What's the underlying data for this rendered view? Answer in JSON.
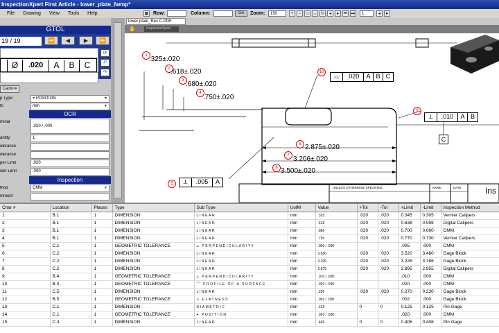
{
  "window": {
    "title": "InspectionXpert First Article - lower_plate_fwmp*",
    "menu": [
      "File",
      "Drawing",
      "View",
      "Tools",
      "Help"
    ]
  },
  "toolbar": {
    "row_label": "Row:",
    "column_label": "Column:",
    "go_label": "Go",
    "zoom_label": "Zoom:",
    "zoom_value": "150",
    "page_value": "1"
  },
  "gtol": {
    "title": "GTOL",
    "counter": "19 / 19",
    "nav": [
      "⏪",
      "◀",
      "▶",
      "⏩"
    ],
    "fcf": {
      "symbol": "Ø",
      "value": ".020",
      "datums": [
        "A",
        "B",
        "C"
      ]
    },
    "capture_label": "Capture"
  },
  "props": {
    "type_label": "p Type",
    "type_value": "POSITION",
    "units_label": "ts",
    "units_value": "mm",
    "ocr_header": "OCR",
    "nominal_label": "minal",
    "nominal_value": ".020 / .000",
    "quantity_label": "antity",
    "quantity_value": "1",
    "tol1_label": "olerance",
    "tol2_label": "olerance",
    "upper_label": "per Limit",
    "upper_value": ".020",
    "lower_label": "wer Limit",
    "lower_value": ".000",
    "inspection_header": "Inspection",
    "method_label": "thod",
    "method_value": "CMM",
    "comment_label": "mment"
  },
  "pdf": {
    "tab_label": "lower plate_Rev C.PDF",
    "subbar_label": "InspectionXpert"
  },
  "drawing": {
    "dims": [
      {
        "num": "1",
        "text": ".325±.020"
      },
      {
        "num": "2",
        "text": ".618±.020"
      },
      {
        "num": "3",
        "text": ".680±.020"
      },
      {
        "num": "4",
        "text": ".750±.020"
      },
      {
        "num": "8",
        "text": "2.875±.020"
      },
      {
        "num": "7",
        "text": "3.206±.020"
      },
      {
        "num": "6",
        "text": "3.500±.020"
      }
    ],
    "balloon10": {
      "num": "10",
      "value": ".020",
      "datums": [
        "A",
        "B",
        "C"
      ]
    },
    "balloon9": {
      "num": "9",
      "value": ".010",
      "datums": [
        "A",
        "B"
      ],
      "datum_below": "C"
    },
    "balloon5": {
      "num": "5",
      "value": ".005",
      "datum": "A"
    },
    "title_block": {
      "note": "UNLESS OTHERWISE SPECIFIED:",
      "name": "NAME",
      "date": "DATE",
      "brand": "Ins"
    }
  },
  "table": {
    "headers": [
      "Char #",
      "Location",
      "Places",
      "Type",
      "Sub Type",
      "UofM",
      "Value",
      "+Tol",
      "-Tol",
      "+Limit",
      "-Limit",
      "Inspection Method"
    ],
    "rows": [
      [
        "1",
        "B.1",
        "1",
        "DIMENSION",
        "LINEAR",
        "mm",
        ".325",
        ".020",
        ".020",
        "0.345",
        "0.305",
        "Vernier Calipers"
      ],
      [
        "2",
        "B.1",
        "1",
        "DIMENSION",
        "LINEAR",
        "mm",
        ".618",
        ".020",
        ".020",
        "0.638",
        "0.598",
        "Digital Calipers"
      ],
      [
        "3",
        "B.1",
        "1",
        "DIMENSION",
        "LINEAR",
        "mm",
        ".680",
        ".020",
        ".020",
        "0.700",
        "0.660",
        "CMM"
      ],
      [
        "4",
        "B.1",
        "1",
        "DIMENSION",
        "LINEAR",
        "mm",
        ".750",
        ".020",
        ".020",
        "0.770",
        "0.730",
        "Vernier Calipers"
      ],
      [
        "5",
        "C.1",
        "1",
        "GEOMETRIC TOLERANCE",
        "⟂ PERPENDICULARITY",
        "mm",
        ".005 / .000",
        "",
        "",
        ".005",
        ".000",
        "CMM"
      ],
      [
        "6",
        "C.2",
        "1",
        "DIMENSION",
        "LINEAR",
        "mm",
        "3.500",
        ".020",
        ".020",
        "3.520",
        "3.480",
        "Gage Block"
      ],
      [
        "7",
        "C.2",
        "1",
        "DIMENSION",
        "LINEAR",
        "mm",
        "3.206",
        ".020",
        ".020",
        "3.226",
        "3.186",
        "Gage Block"
      ],
      [
        "8",
        "C.2",
        "1",
        "DIMENSION",
        "LINEAR",
        "mm",
        "2.875",
        ".020",
        ".020",
        "2.895",
        "2.855",
        "Digital Calipers"
      ],
      [
        "9",
        "B.4",
        "1",
        "GEOMETRIC TOLERANCE",
        "⟂ PERPENDICULARITY",
        "mm",
        ".010 / .000",
        "",
        "",
        ".010",
        ".000",
        "CMM"
      ],
      [
        "10",
        "B.3",
        "1",
        "GEOMETRIC TOLERANCE",
        "⌒ PROFILE OF A SURFACE",
        "mm",
        ".020 / .000",
        "",
        "",
        ".020",
        ".000",
        "CMM"
      ],
      [
        "11",
        "C.5",
        "1",
        "DIMENSION",
        "LINEAR",
        "mm",
        ".250",
        ".020",
        ".020",
        "0.270",
        "0.230",
        "Gage Block"
      ],
      [
        "12",
        "B.5",
        "1",
        "GEOMETRIC TOLERANCE",
        "▱ FLATNESS",
        "mm",
        ".002 / .000",
        "",
        "",
        ".002",
        ".000",
        "Gage Block"
      ],
      [
        "13",
        "C.1",
        "1",
        "DIMENSION",
        "DIAMETRIC",
        "mm",
        ".125",
        "0",
        "0",
        "0.125",
        "0.125",
        "Pin Gage"
      ],
      [
        "14",
        "C.1",
        "1",
        "GEOMETRIC TOLERANCE",
        "⌖ POSITION",
        "mm",
        ".020 / .000",
        "",
        "",
        ".020",
        ".000",
        "CMM"
      ],
      [
        "15",
        "C.3",
        "1",
        "DIMENSION",
        "LINEAR",
        "mm",
        ".406",
        "0",
        "0",
        "0.406",
        "0.406",
        "Pin Gage"
      ]
    ]
  }
}
